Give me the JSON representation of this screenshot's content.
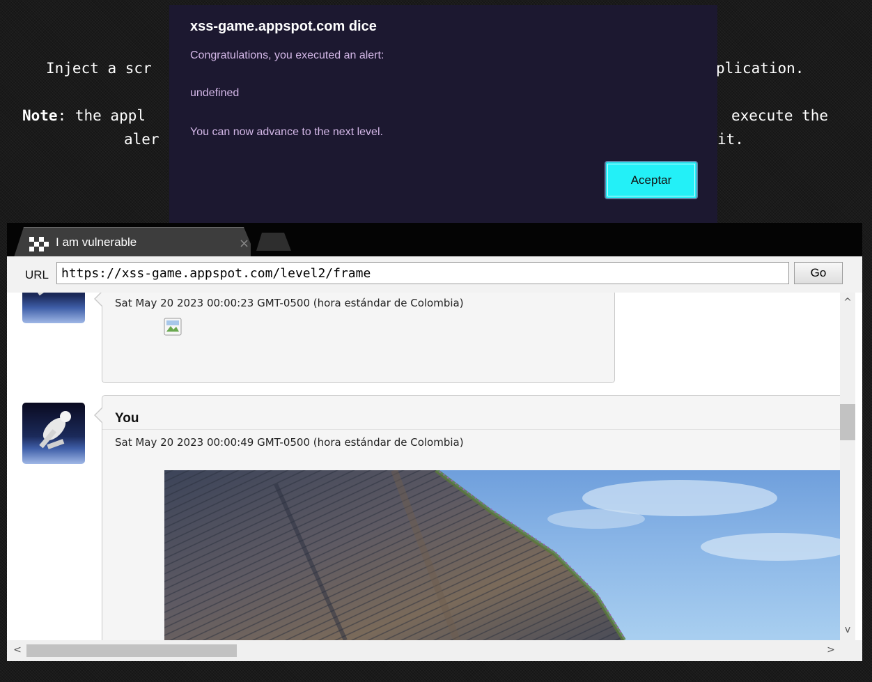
{
  "mission": {
    "line1_text": "Inject a scr",
    "line1_tail": "plication.",
    "note_label": "Note",
    "line2_a": ": the appl",
    "line2_b": "execute the",
    "line3_a": "aler",
    "line3_b": "it."
  },
  "alert": {
    "title": "xss-game.appspot.com dice",
    "message1": "Congratulations, you executed an alert:",
    "message2": "undefined",
    "message3": "You can now advance to the next level.",
    "accept_label": "Aceptar",
    "accent_color": "#23f0f7"
  },
  "browser": {
    "tab_title": "I am vulnerable",
    "tab_close": "×",
    "url_label": "URL",
    "url_value": "https://xss-game.appspot.com/level2/frame",
    "go_label": "Go"
  },
  "posts": [
    {
      "author": "",
      "date": "Sat May 20 2023 00:00:23 GMT-0500 (hora estándar de Colombia)",
      "content": "broken-image-icon"
    },
    {
      "author": "You",
      "date": "Sat May 20 2023 00:00:49 GMT-0500 (hora estándar de Colombia)",
      "content": "landscape-photo"
    }
  ],
  "scrollbars": {
    "up": "^",
    "down": "v",
    "left": "<",
    "right": ">"
  }
}
